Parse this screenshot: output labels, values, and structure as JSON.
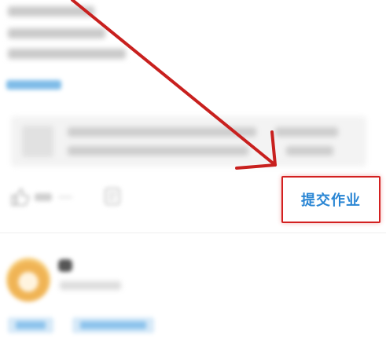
{
  "post": {
    "action_button_label": "提交作业"
  },
  "annotation": {
    "arrow_color": "#c8201e",
    "highlight_border_color": "#d32020"
  },
  "colors": {
    "button_text": "#2a86d4",
    "link_blue": "#7fbce8",
    "background": "#ffffff"
  },
  "icons": [
    "thumbs-up-icon",
    "comment-icon"
  ]
}
